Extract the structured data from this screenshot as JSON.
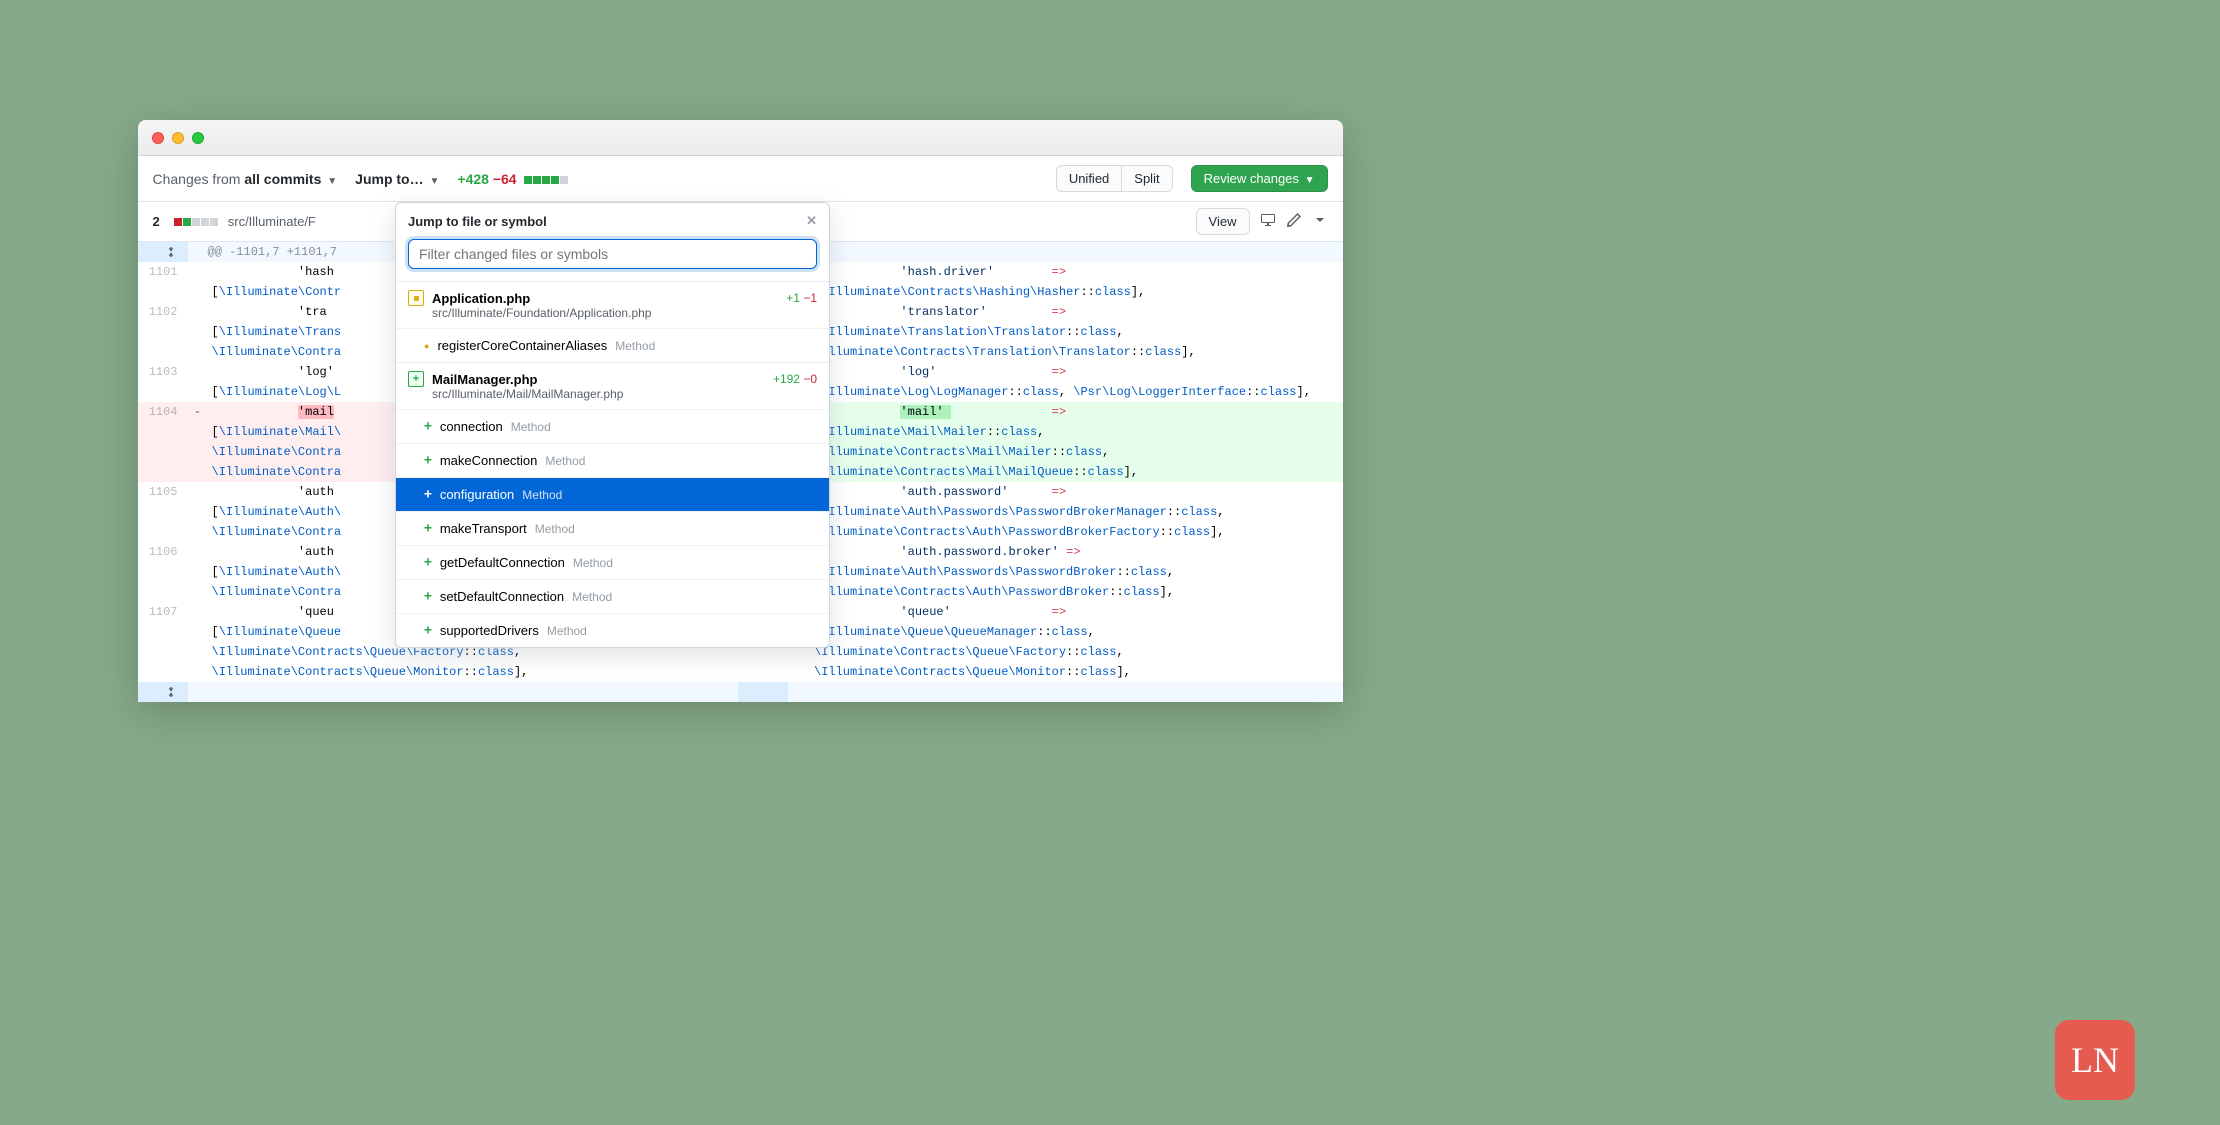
{
  "toolbar": {
    "changes_prefix": "Changes from ",
    "changes_value": "all commits",
    "jump_label": "Jump to…",
    "additions": "+428",
    "deletions": "−64",
    "unified": "Unified",
    "split": "Split",
    "review": "Review changes"
  },
  "filebar": {
    "count": "2",
    "path": "src/Illuminate/F",
    "view": "View"
  },
  "hunk": "@@ -1101,7 +1101,7",
  "popup": {
    "title": "Jump to file or symbol",
    "placeholder": "Filter changed files or symbols",
    "files": [
      {
        "icon": "mod",
        "name": "Application.php",
        "path": "src/Illuminate/Foundation/Application.php",
        "add": "+1",
        "del": "−1",
        "symbols": [
          {
            "marker": "dot",
            "name": "registerCoreContainerAliases",
            "kind": "Method",
            "selected": false
          }
        ]
      },
      {
        "icon": "add",
        "name": "MailManager.php",
        "path": "src/Illuminate/Mail/MailManager.php",
        "add": "+192",
        "del": "−0",
        "symbols": [
          {
            "marker": "plus",
            "name": "connection",
            "kind": "Method",
            "selected": false
          },
          {
            "marker": "plus",
            "name": "makeConnection",
            "kind": "Method",
            "selected": false
          },
          {
            "marker": "plus",
            "name": "configuration",
            "kind": "Method",
            "selected": true
          },
          {
            "marker": "plus",
            "name": "makeTransport",
            "kind": "Method",
            "selected": false
          },
          {
            "marker": "plus",
            "name": "getDefaultConnection",
            "kind": "Method",
            "selected": false
          },
          {
            "marker": "plus",
            "name": "setDefaultConnection",
            "kind": "Method",
            "selected": false
          },
          {
            "marker": "plus",
            "name": "supportedDrivers",
            "kind": "Method",
            "selected": false
          }
        ]
      }
    ]
  },
  "left_lines": [
    {
      "num": "1101",
      "mark": "",
      "cls": "",
      "html": "            'hash"
    },
    {
      "num": "",
      "mark": "",
      "cls": "",
      "html": "[<span class=\"t-ns\">\\Illuminate\\Contr</span>"
    },
    {
      "num": "1102",
      "mark": "",
      "cls": "",
      "html": "            'tra"
    },
    {
      "num": "",
      "mark": "",
      "cls": "",
      "html": "[<span class=\"t-ns\">\\Illuminate\\Trans</span>"
    },
    {
      "num": "",
      "mark": "",
      "cls": "",
      "html": "<span class=\"t-ns\">\\Illuminate\\Contra</span>"
    },
    {
      "num": "1103",
      "mark": "",
      "cls": "",
      "html": "            'log'"
    },
    {
      "num": "",
      "mark": "",
      "cls": "",
      "html": "[<span class=\"t-ns\">\\Illuminate\\Log\\L</span>"
    },
    {
      "num": "1104",
      "mark": "-",
      "cls": "del",
      "html": "            <span class=\"hlr\">'mail</span>"
    },
    {
      "num": "",
      "mark": "",
      "cls": "del",
      "html": "[<span class=\"t-ns\">\\Illuminate\\Mail\\</span>"
    },
    {
      "num": "",
      "mark": "",
      "cls": "del",
      "html": "<span class=\"t-ns\">\\Illuminate\\Contra</span>"
    },
    {
      "num": "",
      "mark": "",
      "cls": "del",
      "html": "<span class=\"t-ns\">\\Illuminate\\Contra</span>"
    },
    {
      "num": "1105",
      "mark": "",
      "cls": "",
      "html": "            'auth"
    },
    {
      "num": "",
      "mark": "",
      "cls": "",
      "html": "[<span class=\"t-ns\">\\Illuminate\\Auth\\</span>"
    },
    {
      "num": "",
      "mark": "",
      "cls": "",
      "html": "<span class=\"t-ns\">\\Illuminate\\Contra</span>"
    },
    {
      "num": "1106",
      "mark": "",
      "cls": "",
      "html": "            'auth"
    },
    {
      "num": "",
      "mark": "",
      "cls": "",
      "html": "[<span class=\"t-ns\">\\Illuminate\\Auth\\</span>"
    },
    {
      "num": "",
      "mark": "",
      "cls": "",
      "html": "<span class=\"t-ns\">\\Illuminate\\Contra</span>"
    },
    {
      "num": "1107",
      "mark": "",
      "cls": "",
      "html": "            'queu"
    },
    {
      "num": "",
      "mark": "",
      "cls": "",
      "html": "[<span class=\"t-ns\">\\Illuminate\\Queue</span>"
    },
    {
      "num": "",
      "mark": "",
      "cls": "",
      "html": "<span class=\"t-ns\">\\Illuminate\\Contracts\\Queue\\Factory</span>::<span class=\"t-key\">class</span>,"
    },
    {
      "num": "",
      "mark": "",
      "cls": "",
      "html": "<span class=\"t-ns\">\\Illuminate\\Contracts\\Queue\\Monitor</span>::<span class=\"t-key\">class</span>],"
    }
  ],
  "right_lines": [
    {
      "num": "",
      "mark": "",
      "cls": "",
      "html": "            <span class=\"t-str\">'hash.driver'</span>        <span class=\"t-arrow\">=></span>"
    },
    {
      "num": "",
      "mark": "",
      "cls": "",
      "html": "[<span class=\"t-ns\">\\Illuminate\\Contracts\\Hashing\\Hasher</span>::<span class=\"t-key\">class</span>],"
    },
    {
      "num": "",
      "mark": "",
      "cls": "",
      "html": "            <span class=\"t-str\">'translator'</span>         <span class=\"t-arrow\">=></span>"
    },
    {
      "num": "",
      "mark": "",
      "cls": "",
      "html": "[<span class=\"t-ns\">\\Illuminate\\Translation\\Translator</span>::<span class=\"t-key\">class</span>,"
    },
    {
      "num": "",
      "mark": "",
      "cls": "",
      "html": "<span class=\"t-ns\">\\Illuminate\\Contracts\\Translation\\Translator</span>::<span class=\"t-key\">class</span>],"
    },
    {
      "num": "",
      "mark": "",
      "cls": "",
      "html": "            <span class=\"t-str\">'log'</span>                <span class=\"t-arrow\">=></span>"
    },
    {
      "num": "",
      "mark": "",
      "cls": "",
      "html": "[<span class=\"t-ns\">\\Illuminate\\Log\\LogManager</span>::<span class=\"t-key\">class</span>, <span class=\"t-ns\">\\Psr\\Log\\LoggerInterface</span>::<span class=\"t-key\">class</span>],"
    },
    {
      "num": "",
      "mark": "+",
      "cls": "add",
      "html": "            <span class=\"hlg\">'mail' </span>              <span class=\"t-arrow\">=></span>"
    },
    {
      "num": "",
      "mark": "",
      "cls": "add",
      "html": "[<span class=\"t-ns\">\\Illuminate\\Mail\\Mailer</span>::<span class=\"t-key\">class</span>,"
    },
    {
      "num": "",
      "mark": "",
      "cls": "add",
      "html": "<span class=\"t-ns\">\\Illuminate\\Contracts\\Mail\\Mailer</span>::<span class=\"t-key\">class</span>,"
    },
    {
      "num": "",
      "mark": "",
      "cls": "add",
      "html": "<span class=\"t-ns\">\\Illuminate\\Contracts\\Mail\\MailQueue</span>::<span class=\"t-key\">class</span>],"
    },
    {
      "num": "",
      "mark": "",
      "cls": "",
      "html": "            <span class=\"t-str\">'auth.password'</span>      <span class=\"t-arrow\">=></span>"
    },
    {
      "num": "",
      "mark": "",
      "cls": "",
      "html": "[<span class=\"t-ns\">\\Illuminate\\Auth\\Passwords\\PasswordBrokerManager</span>::<span class=\"t-key\">class</span>,"
    },
    {
      "num": "",
      "mark": "",
      "cls": "",
      "html": "<span class=\"t-ns\">\\Illuminate\\Contracts\\Auth\\PasswordBrokerFactory</span>::<span class=\"t-key\">class</span>],"
    },
    {
      "num": "",
      "mark": "",
      "cls": "",
      "html": "            <span class=\"t-str\">'auth.password.broker'</span> <span class=\"t-arrow\">=></span>"
    },
    {
      "num": "",
      "mark": "",
      "cls": "",
      "html": "[<span class=\"t-ns\">\\Illuminate\\Auth\\Passwords\\PasswordBroker</span>::<span class=\"t-key\">class</span>,"
    },
    {
      "num": "",
      "mark": "",
      "cls": "",
      "html": "<span class=\"t-ns\">\\Illuminate\\Contracts\\Auth\\PasswordBroker</span>::<span class=\"t-key\">class</span>],"
    },
    {
      "num": "",
      "mark": "",
      "cls": "",
      "html": "            <span class=\"t-str\">'queue'</span>              <span class=\"t-arrow\">=></span>"
    },
    {
      "num": "",
      "mark": "",
      "cls": "",
      "html": "[<span class=\"t-ns\">\\Illuminate\\Queue\\QueueManager</span>::<span class=\"t-key\">class</span>,"
    },
    {
      "num": "",
      "mark": "",
      "cls": "",
      "html": "<span class=\"t-ns\">\\Illuminate\\Contracts\\Queue\\Factory</span>::<span class=\"t-key\">class</span>,"
    },
    {
      "num": "",
      "mark": "",
      "cls": "",
      "html": "<span class=\"t-ns\">\\Illuminate\\Contracts\\Queue\\Monitor</span>::<span class=\"t-key\">class</span>],"
    }
  ],
  "logo": "LN"
}
